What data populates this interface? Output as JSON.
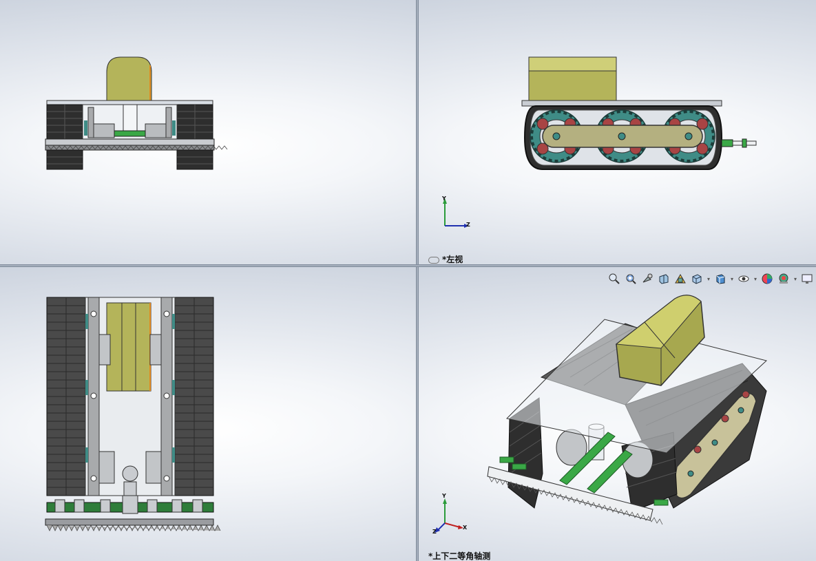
{
  "viewports": {
    "top_left": {
      "label": ""
    },
    "top_right": {
      "label": "*左视",
      "triad": {
        "y": "Y",
        "z": "Z"
      }
    },
    "bottom_left": {
      "label": ""
    },
    "bottom_right": {
      "label": "*上下二等角轴测",
      "triad": {
        "y": "Y",
        "x": "X",
        "z": "Z"
      }
    }
  },
  "heads_up_toolbar": {
    "icons": [
      "zoom-to-fit-icon",
      "zoom-to-area-icon",
      "previous-view-icon",
      "section-view-icon",
      "dynamic-annotation-icon",
      "display-style-icon",
      "view-orientation-icon",
      "hide-show-items-icon",
      "edit-appearance-icon",
      "apply-scene-icon",
      "view-settings-icon"
    ]
  },
  "colors": {
    "body_olive": "#b4b45a",
    "track_dark": "#2e2e2e",
    "wheel_teal": "#3f8c86",
    "roller_red": "#a84444",
    "green_part": "#3aa846",
    "frame_gray": "#a8aaac"
  }
}
